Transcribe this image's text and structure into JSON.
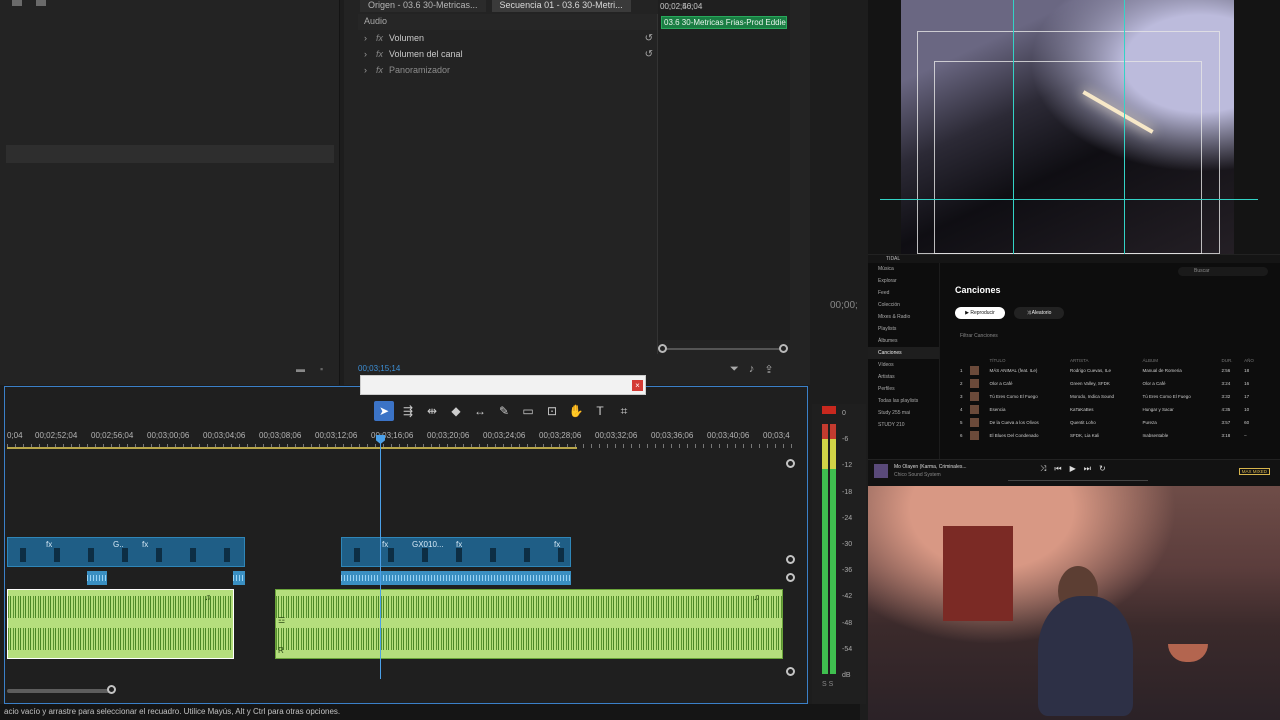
{
  "tabs": [
    "Origen - 03.6 30-Metricas...",
    "Secuencia 01 - 03.6 30-Metri..."
  ],
  "effects": {
    "section": "Audio",
    "items": [
      {
        "label": "Volumen",
        "dim": false
      },
      {
        "label": "Volumen del canal",
        "dim": false
      },
      {
        "label": "Panoramizador",
        "dim": true
      }
    ],
    "fx_symbol": "fx",
    "time_left": "00;02;40;04",
    "time_right": "00;02;56;04",
    "clip_name": "03.6 30-Metricas Frias-Prod Eddie",
    "current_tc": "00;03;15;14",
    "side_tc": "00;00;"
  },
  "timeline": {
    "ruler": [
      "0;04",
      "00;02;52;04",
      "00;02;56;04",
      "00;03;00;06",
      "00;03;04;06",
      "00;03;08;06",
      "00;03;12;06",
      "00;03;16;06",
      "00;03;20;06",
      "00;03;24;06",
      "00;03;28;06",
      "00;03;32;06",
      "00;03;36;06",
      "00;03;40;06",
      "00;03;4"
    ],
    "video_labels": [
      "G..",
      "GX010..."
    ],
    "fx_tag": "fx",
    "audio_badges": [
      "☲",
      "R"
    ]
  },
  "meter_scale": [
    "0",
    "-6",
    "-12",
    "-18",
    "-24",
    "-30",
    "-36",
    "-42",
    "-48",
    "-54",
    "dB"
  ],
  "meter_solo": "S S",
  "status": "acio vacío y arrastre para seleccionar el recuadro. Utilice Mayús, Alt y Ctrl para otras opciones.",
  "tidal": {
    "app": "TIDAL",
    "nav": [
      "Música",
      "Explorar",
      "Feed",
      "Colección",
      "Mixes & Radio",
      "Playlists",
      "Álbumes",
      "Canciones",
      "Vídeos",
      "Artistas",
      "Perfiles",
      "Todas las playlists",
      "Study 255 mai",
      "STUDY 210"
    ],
    "title": "Canciones",
    "play": "▶ Reproducir",
    "shuffle": "⤨ Aleatorio",
    "filter": "Filtrar Canciones",
    "search": "Buscar",
    "columns": [
      "TÍTULO",
      "ARTISTA",
      "ÁLBUM",
      "DUR.",
      "AÑO"
    ],
    "rows": [
      {
        "n": "1",
        "t": "MÁS ANIMAL (feat. ILe)",
        "a": "Rodrigo Cuevas, ILe",
        "al": "Manual de Romeria",
        "d": "2:56",
        "y": "18"
      },
      {
        "n": "2",
        "t": "Olor a Café",
        "a": "Green Valley, SFDK",
        "al": "Olor a Café",
        "d": "3:24",
        "y": "16"
      },
      {
        "n": "3",
        "t": "Tú Eres Como El Fuego",
        "a": "Morodo, Indica Sound",
        "al": "Tú Eres Como El Fuego",
        "d": "3:32",
        "y": "17"
      },
      {
        "n": "4",
        "t": "Esencia",
        "a": "KaTaKaBes",
        "al": "Hungar y Sacar",
        "d": "4:35",
        "y": "10"
      },
      {
        "n": "5",
        "t": "De la Cueva a los Olivos",
        "a": "Quentit Loho",
        "al": "Pureza",
        "d": "3:57",
        "y": "60"
      },
      {
        "n": "6",
        "t": "El Blues Del Condenado",
        "a": "SFDK, Lia Kali",
        "al": "Inabsentable",
        "d": "3:18",
        "y": "–"
      }
    ],
    "now_playing": "Mo Olayen (Karma, Criminales...",
    "now_artist": "Chico Sound System",
    "quality": "MAX MIXED"
  }
}
